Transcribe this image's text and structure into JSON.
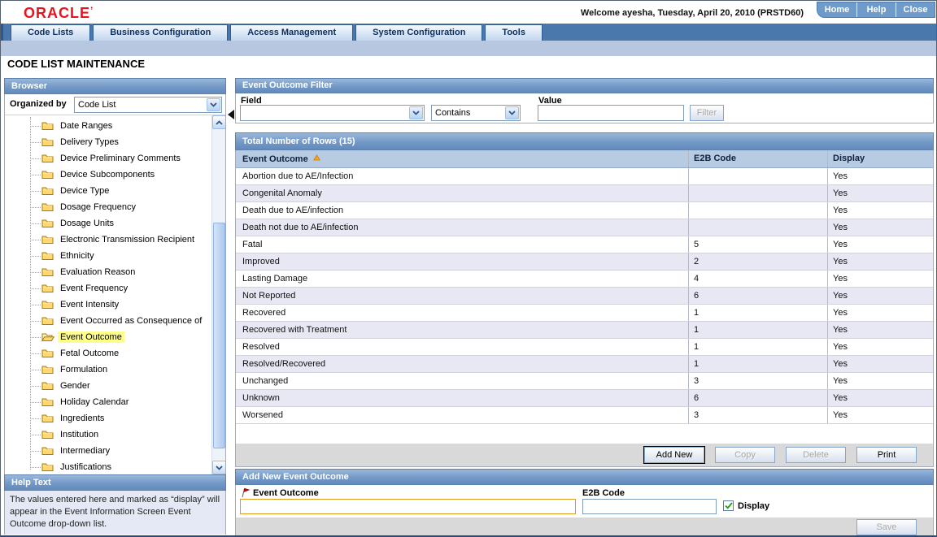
{
  "colors": {
    "logo_red": "#e8131c",
    "section_header_blue": "#6289bb",
    "nav_bar_blue": "#4a78ac",
    "sub_bar_blue": "#b6c7df",
    "column_header_bg": "#b7cbe3",
    "row_alt_bg": "#e7e8f3",
    "selected_item_highlight": "#ffff8c",
    "required_input_border": "#e09b1e",
    "disabled_text": "#a8a8a8",
    "check_green": "#1fa11f",
    "sort_icon_orange": "#f5a623"
  },
  "header": {
    "logo_text": "ORACLE",
    "welcome_text": "Welcome ayesha, Tuesday, April 20, 2010 (PRSTD60)",
    "links": [
      "Home",
      "Help",
      "Close"
    ]
  },
  "nav": {
    "tabs": [
      "Code Lists",
      "Business Configuration",
      "Access Management",
      "System Configuration",
      "Tools"
    ]
  },
  "page_title": "CODE LIST MAINTENANCE",
  "browser": {
    "title": "Browser",
    "organized_by_label": "Organized by",
    "organized_by_value": "Code List",
    "selected_item": "Event Outcome",
    "items": [
      "Date Ranges",
      "Delivery Types",
      "Device Preliminary Comments",
      "Device Subcomponents",
      "Device Type",
      "Dosage Frequency",
      "Dosage Units",
      "Electronic Transmission Recipient",
      "Ethnicity",
      "Evaluation Reason",
      "Event Frequency",
      "Event Intensity",
      "Event Occurred as Consequence of",
      "Event Outcome",
      "Fetal Outcome",
      "Formulation",
      "Gender",
      "Holiday Calendar",
      "Ingredients",
      "Institution",
      "Intermediary",
      "Justifications"
    ]
  },
  "help": {
    "title": "Help Text",
    "body": "The values entered here and marked as “display” will appear in the Event Information Screen Event Outcome drop-down list."
  },
  "filter": {
    "title": "Event Outcome Filter",
    "field_label": "Field",
    "field_value": "",
    "operator_value": "Contains",
    "value_label": "Value",
    "value_text": "",
    "filter_button_label": "Filter",
    "filter_button_enabled": false
  },
  "table": {
    "title": "Total Number of Rows (15)",
    "columns": [
      "Event Outcome",
      "E2B Code",
      "Display"
    ],
    "sorted_column": "Event Outcome",
    "sort_direction": "asc",
    "rows": [
      {
        "event_outcome": "Abortion due to AE/Infection",
        "e2b_code": "",
        "display": "Yes"
      },
      {
        "event_outcome": "Congenital Anomaly",
        "e2b_code": "",
        "display": "Yes"
      },
      {
        "event_outcome": "Death due to AE/infection",
        "e2b_code": "",
        "display": "Yes"
      },
      {
        "event_outcome": "Death not due to AE/infection",
        "e2b_code": "",
        "display": "Yes"
      },
      {
        "event_outcome": "Fatal",
        "e2b_code": "5",
        "display": "Yes"
      },
      {
        "event_outcome": "Improved",
        "e2b_code": "2",
        "display": "Yes"
      },
      {
        "event_outcome": "Lasting Damage",
        "e2b_code": "4",
        "display": "Yes"
      },
      {
        "event_outcome": "Not Reported",
        "e2b_code": "6",
        "display": "Yes"
      },
      {
        "event_outcome": "Recovered",
        "e2b_code": "1",
        "display": "Yes"
      },
      {
        "event_outcome": "Recovered with Treatment",
        "e2b_code": "1",
        "display": "Yes"
      },
      {
        "event_outcome": "Resolved",
        "e2b_code": "1",
        "display": "Yes"
      },
      {
        "event_outcome": "Resolved/Recovered",
        "e2b_code": "1",
        "display": "Yes"
      },
      {
        "event_outcome": "Unchanged",
        "e2b_code": "3",
        "display": "Yes"
      },
      {
        "event_outcome": "Unknown",
        "e2b_code": "6",
        "display": "Yes"
      },
      {
        "event_outcome": "Worsened",
        "e2b_code": "3",
        "display": "Yes"
      }
    ]
  },
  "actions": {
    "add_new": "Add New",
    "copy": "Copy",
    "delete": "Delete",
    "print": "Print",
    "copy_enabled": false,
    "delete_enabled": false
  },
  "add_form": {
    "title": "Add New Event Outcome",
    "event_outcome_label": "Event Outcome",
    "event_outcome_value": "",
    "e2b_code_label": "E2B Code",
    "e2b_code_value": "",
    "display_label": "Display",
    "display_checked": true,
    "save_button_label": "Save",
    "save_button_enabled": false
  }
}
